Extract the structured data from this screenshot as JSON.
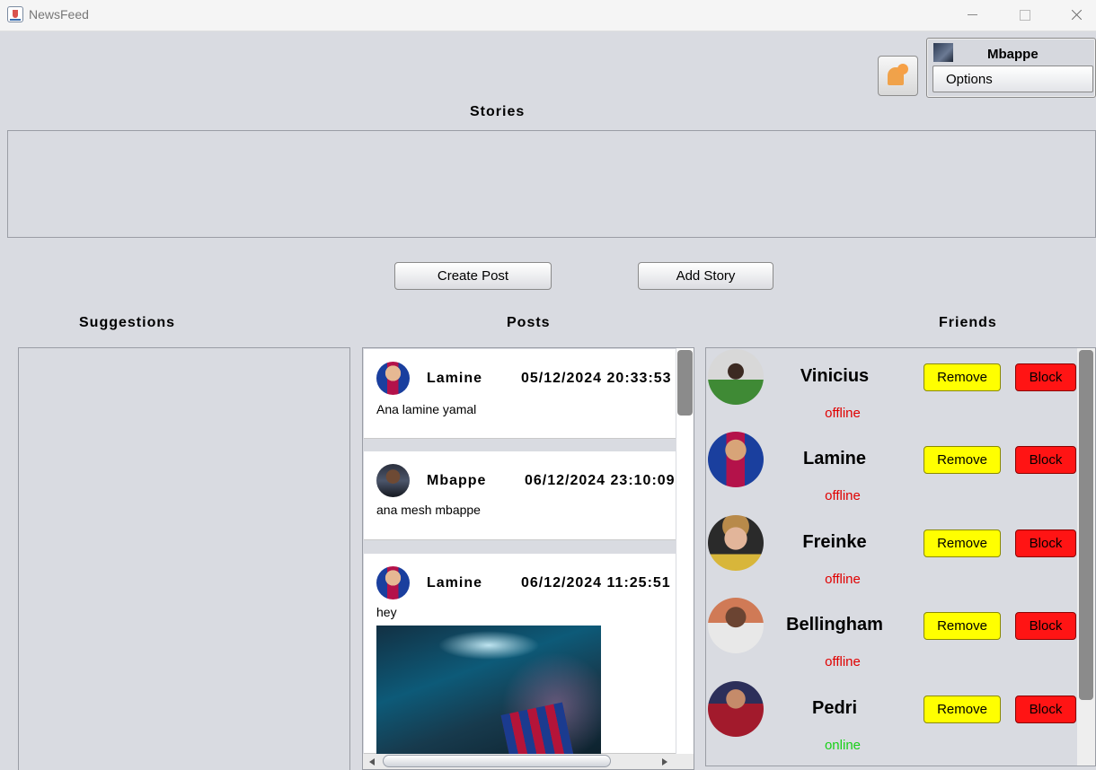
{
  "window": {
    "title": "NewsFeed"
  },
  "user": {
    "name": "Mbappe",
    "options_label": "Options"
  },
  "headings": {
    "stories": "Stories",
    "suggestions": "Suggestions",
    "posts": "Posts",
    "friends": "Friends"
  },
  "actions": {
    "create_post": "Create Post",
    "add_story": "Add Story"
  },
  "posts": [
    {
      "author": "Lamine",
      "date": "05/12/2024 20:33:53",
      "text": "Ana lamine yamal",
      "has_image": false
    },
    {
      "author": "Mbappe",
      "date": "06/12/2024 23:10:09",
      "text": "ana mesh mbappe",
      "has_image": false
    },
    {
      "author": "Lamine",
      "date": "06/12/2024 11:25:51",
      "text": "hey",
      "has_image": true
    }
  ],
  "friends": [
    {
      "name": "Vinicius",
      "status": "offline",
      "remove_label": "Remove",
      "block_label": "Block"
    },
    {
      "name": "Lamine",
      "status": "offline",
      "remove_label": "Remove",
      "block_label": "Block"
    },
    {
      "name": "Freinke",
      "status": "offline",
      "remove_label": "Remove",
      "block_label": "Block"
    },
    {
      "name": "Bellingham",
      "status": "offline",
      "remove_label": "Remove",
      "block_label": "Block"
    },
    {
      "name": "Pedri",
      "status": "online",
      "remove_label": "Remove",
      "block_label": "Block"
    }
  ],
  "colors": {
    "offline": "#e00000",
    "online": "#18d018",
    "remove_button": "#ffff00",
    "block_button": "#ff1414",
    "notification": "#f0a24a"
  },
  "icons": {
    "notification": "bell-icon"
  }
}
